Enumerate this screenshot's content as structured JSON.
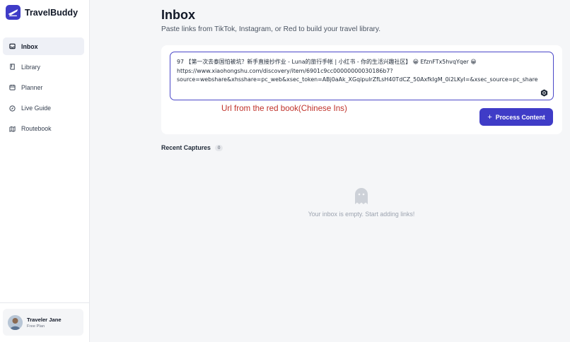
{
  "app": {
    "name": "TravelBuddy",
    "accent_color": "#3f3cc7"
  },
  "sidebar": {
    "items": [
      {
        "label": "Inbox",
        "icon": "inbox-icon",
        "active": true
      },
      {
        "label": "Library",
        "icon": "book-icon",
        "active": false
      },
      {
        "label": "Planner",
        "icon": "calendar-icon",
        "active": false
      },
      {
        "label": "Live Guide",
        "icon": "compass-icon",
        "active": false
      },
      {
        "label": "Routebook",
        "icon": "map-icon",
        "active": false
      }
    ],
    "user": {
      "name": "Traveler Jane",
      "plan": "Free Plan"
    }
  },
  "main": {
    "title": "Inbox",
    "subtitle": "Paste links from TikTok, Instagram, or Red to build your travel library.",
    "input": {
      "lines": [
        "97 【第一次去泰国怕被坑？新手直接抄作业 - Luna的旅行手帐 | 小红书 - 你的生活兴趣社区】 😀 EfznFTx5hvqYqer 😀",
        "https://www.xiaohongshu.com/discovery/item/6901c9cc00000000030186b7?",
        "source=webshare&xhsshare=pc_web&xsec_token=ABj0aAk_XGqipulrZfLsH40TdCZ_50AxfkIgM_0i2LKyI=&xsec_source=pc_share"
      ]
    },
    "annotation": "Url from the red book(Chinese Ins)",
    "process_button": "Process Content",
    "recent": {
      "label": "Recent Captures",
      "count": "0"
    },
    "empty_text": "Your inbox is empty. Start adding links!"
  }
}
